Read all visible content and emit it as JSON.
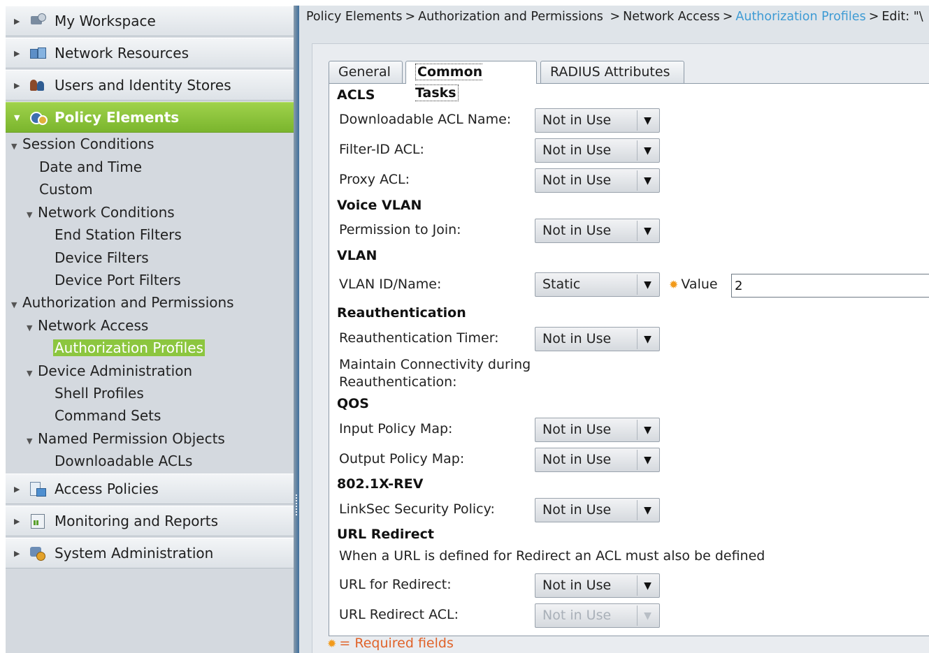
{
  "sidebar": {
    "drawers": [
      {
        "label": "My Workspace",
        "icon": "workspace-icon"
      },
      {
        "label": "Network Resources",
        "icon": "network-resources-icon"
      },
      {
        "label": "Users and Identity Stores",
        "icon": "users-icon"
      },
      {
        "label": "Policy Elements",
        "icon": "policy-elements-icon"
      },
      {
        "label": "Access Policies",
        "icon": "access-policies-icon"
      },
      {
        "label": "Monitoring and Reports",
        "icon": "monitoring-icon"
      },
      {
        "label": "System Administration",
        "icon": "system-admin-icon"
      }
    ],
    "tree": [
      "Session Conditions",
      "Date and Time",
      "Custom",
      "Network Conditions",
      "End Station Filters",
      "Device Filters",
      "Device Port Filters",
      "Authorization and Permissions",
      "Network Access",
      "Authorization Profiles",
      "Device Administration",
      "Shell Profiles",
      "Command Sets",
      "Named Permission Objects",
      "Downloadable ACLs"
    ]
  },
  "breadcrumb": {
    "items": [
      "Policy Elements",
      "Authorization and Permissions",
      "Network Access"
    ],
    "link": "Authorization Profiles",
    "tail": "Edit: \"\\"
  },
  "tabs": [
    "General",
    "Common Tasks",
    "RADIUS Attributes"
  ],
  "form": {
    "sections": {
      "acls": "ACLS",
      "voice_vlan": "Voice VLAN",
      "vlan": "VLAN",
      "reauth": "Reauthentication",
      "qos": "QOS",
      "dot1x": "802.1X-REV",
      "url_redirect": "URL Redirect"
    },
    "labels": {
      "downloadable_acl": "Downloadable ACL Name:",
      "filter_id_acl": "Filter-ID ACL:",
      "proxy_acl": "Proxy ACL:",
      "permission_to_join": "Permission to Join:",
      "vlan_id": "VLAN ID/Name:",
      "reauth_timer": "Reauthentication Timer:",
      "maintain_line1": "Maintain Connectivity during",
      "maintain_line2": "Reauthentication:",
      "input_policy": "Input Policy Map:",
      "output_policy": "Output Policy Map:",
      "linksec": "LinkSec Security Policy:",
      "url_note": "When a URL is defined for Redirect an ACL must also be defined",
      "url_for_redirect": "URL for Redirect:",
      "url_redirect_acl": "URL Redirect ACL:"
    },
    "values": {
      "downloadable_acl": "Not in Use",
      "filter_id_acl": "Not in Use",
      "proxy_acl": "Not in Use",
      "permission_to_join": "Not in Use",
      "vlan_id": "Static",
      "reauth_timer": "Not in Use",
      "input_policy": "Not in Use",
      "output_policy": "Not in Use",
      "linksec": "Not in Use",
      "url_for_redirect": "Not in Use",
      "url_redirect_acl": "Not in Use"
    },
    "vlan_value_label": "Value",
    "vlan_value": "2",
    "required_note": "= Required fields"
  },
  "colors": {
    "active_drawer": "#8cc63f",
    "link": "#3e9bd4",
    "required": "#e0632a"
  }
}
